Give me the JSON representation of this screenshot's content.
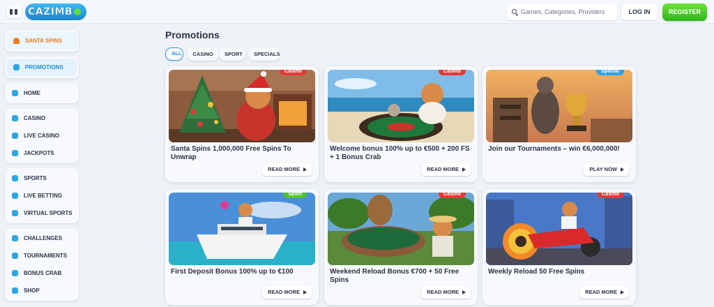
{
  "header": {
    "logo": "CAZIMB",
    "search_placeholder": "Games, Categories, Providers",
    "login_label": "LOG IN",
    "register_label": "REGISTER"
  },
  "sidebar": {
    "groups": [
      [
        {
          "label": "SANTA SPINS",
          "icon": "bell-icon"
        }
      ],
      [
        {
          "label": "PROMOTIONS",
          "icon": "gift-icon"
        }
      ],
      [
        {
          "label": "HOME",
          "icon": "home-icon"
        }
      ],
      [
        {
          "label": "CASINO",
          "icon": "slot-icon"
        },
        {
          "label": "LIVE CASINO",
          "icon": "chip-icon"
        },
        {
          "label": "JACKPOTS",
          "icon": "jackpot-icon"
        }
      ],
      [
        {
          "label": "SPORTS",
          "icon": "ball-icon"
        },
        {
          "label": "LIVE BETTING",
          "icon": "play-icon"
        },
        {
          "label": "VIRTUAL SPORTS",
          "icon": "gamepad-icon"
        }
      ],
      [
        {
          "label": "CHALLENGES",
          "icon": "medal-icon"
        },
        {
          "label": "TOURNAMENTS",
          "icon": "trophy-icon"
        },
        {
          "label": "BONUS CRAB",
          "icon": "crab-icon"
        },
        {
          "label": "SHOP",
          "icon": "shop-icon"
        }
      ]
    ]
  },
  "main": {
    "title": "Promotions",
    "filters": [
      "ALL",
      "CASINO",
      "SPORT",
      "SPECIALS"
    ],
    "active_filter": "ALL",
    "cards": [
      {
        "tag": "Casino",
        "title": "Santa Spins 1,000,000 Free Spins To Unwrap",
        "button": "READ MORE"
      },
      {
        "tag": "Casino",
        "title": "Welcome bonus 100% up to €500 + 200 FS + 1 Bonus Crab",
        "button": "READ MORE"
      },
      {
        "tag": "Special",
        "title": "Join our Tournaments – win €6,000,000!",
        "button": "PLAY NOW"
      },
      {
        "tag": "Sport",
        "title": "First Deposit Bonus 100% up to €100",
        "button": "READ MORE"
      },
      {
        "tag": "Casino",
        "title": "Weekend Reload Bonus €700 + 50 Free Spins",
        "button": "READ MORE"
      },
      {
        "tag": "Casino",
        "title": "Weekly Reload 50 Free Spins",
        "button": "READ MORE"
      }
    ]
  },
  "colors": {
    "accent": "#2da5e3",
    "register": "#3cc223",
    "casino_tag": "#e23a3a",
    "sport_tag": "#4fc42f",
    "special_tag": "#2aa4ea",
    "santa": "#f07a1a"
  }
}
